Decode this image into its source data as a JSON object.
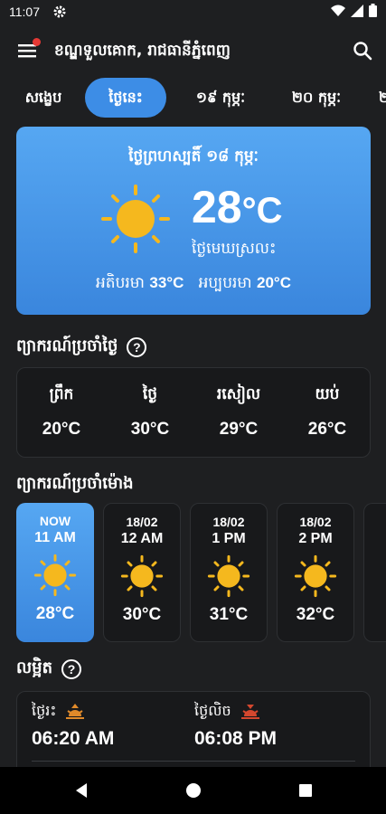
{
  "status": {
    "time": "11:07"
  },
  "app": {
    "title": "ខណ្ឌទួលគោក, រាជធានីភ្នំពេញ"
  },
  "tabs": [
    {
      "label": "សង្ខេប"
    },
    {
      "label": "ថ្ងៃនេះ",
      "active": true
    },
    {
      "label": "១៩ កុម្ភៈ"
    },
    {
      "label": "២០ កុម្ភៈ"
    },
    {
      "label": "២"
    }
  ],
  "today": {
    "date": "ថ្ងៃព្រហស្បតិ៍ ១៨ កុម្ភៈ",
    "temp": "28",
    "unit": "°C",
    "condition": "ថ្ងៃមេឃស្រលះ",
    "max_label": "អតិបរមា",
    "max_value": "33°C",
    "min_label": "អប្បបរមា",
    "min_value": "20°C",
    "icon": "sun-icon"
  },
  "daily": {
    "title": "ព្យាករណ៍ប្រចាំថ្ងៃ",
    "parts": [
      {
        "label": "ព្រឹក",
        "temp": "20°C"
      },
      {
        "label": "ថ្ងៃ",
        "temp": "30°C"
      },
      {
        "label": "រសៀល",
        "temp": "29°C"
      },
      {
        "label": "យប់",
        "temp": "26°C"
      }
    ]
  },
  "hourly": {
    "title": "ព្យាករណ៍ប្រចាំម៉ោង",
    "items": [
      {
        "date": "NOW",
        "hour": "11 AM",
        "temp": "28°C",
        "icon": "sun-icon"
      },
      {
        "date": "18/02",
        "hour": "12 AM",
        "temp": "30°C",
        "icon": "sun-icon"
      },
      {
        "date": "18/02",
        "hour": "1 PM",
        "temp": "31°C",
        "icon": "sun-icon"
      },
      {
        "date": "18/02",
        "hour": "2 PM",
        "temp": "32°C",
        "icon": "sun-icon"
      }
    ]
  },
  "sun": {
    "title": "លម្អិត",
    "sunrise_label": "ថ្ងៃរះ",
    "sunrise": "06:20 AM",
    "sunset_label": "ថ្ងៃលិច",
    "sunset": "06:08 PM"
  },
  "colors": {
    "accent": "#3d8de6",
    "background": "#1e1f21",
    "sun": "#f5b81e"
  }
}
